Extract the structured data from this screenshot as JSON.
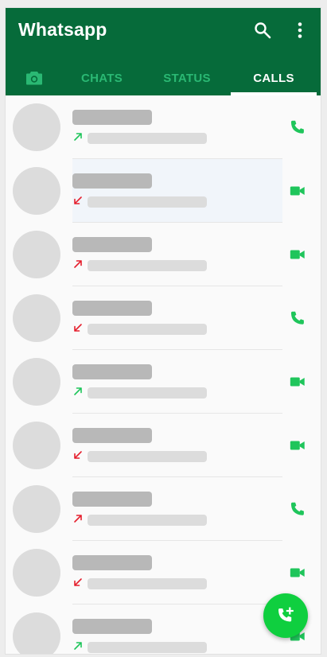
{
  "app": {
    "title": "Whatsapp"
  },
  "header": {
    "search_icon": "search-icon",
    "more_icon": "more-vert-icon"
  },
  "tabs": {
    "camera_icon": "camera-icon",
    "chats": "CHATS",
    "status": "STATUS",
    "calls": "CALLS",
    "active": "calls"
  },
  "colors": {
    "app_bar": "#066b3a",
    "tab_inactive": "#2ab873",
    "tab_active": "#ffffff",
    "call_icon": "#1fc55b",
    "outgoing_arrow": "#1fc55b",
    "missed_arrow": "#e5202e",
    "fab": "#0fcf3f"
  },
  "calls": [
    {
      "direction": "outgoing",
      "call_type": "voice",
      "highlighted": false
    },
    {
      "direction": "missed",
      "call_type": "video",
      "highlighted": true
    },
    {
      "direction": "outgoing-missed",
      "call_type": "video",
      "highlighted": false
    },
    {
      "direction": "missed",
      "call_type": "voice",
      "highlighted": false
    },
    {
      "direction": "outgoing",
      "call_type": "video",
      "highlighted": false
    },
    {
      "direction": "missed",
      "call_type": "video",
      "highlighted": false
    },
    {
      "direction": "outgoing-missed",
      "call_type": "voice",
      "highlighted": false
    },
    {
      "direction": "missed",
      "call_type": "video",
      "highlighted": false
    },
    {
      "direction": "outgoing",
      "call_type": "video",
      "highlighted": false
    }
  ],
  "fab": {
    "icon": "add-call-icon"
  }
}
